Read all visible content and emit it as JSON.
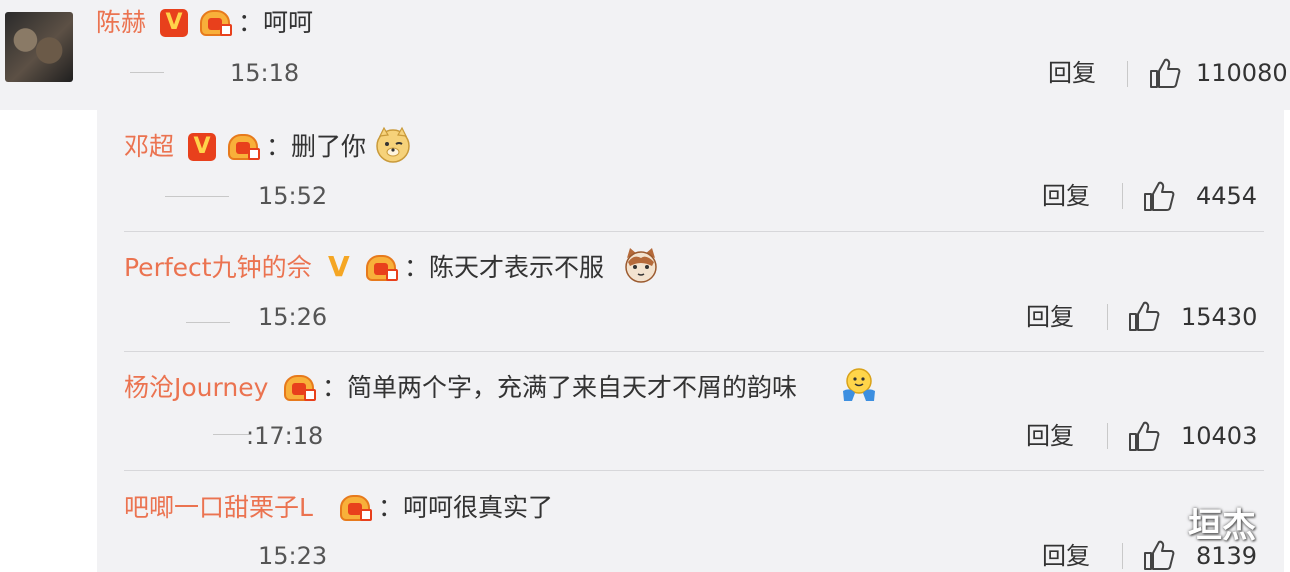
{
  "main_comment": {
    "user": "陈赫",
    "text": "：呵呵",
    "time": "15:18",
    "reply_label": "回复",
    "likes": "110080"
  },
  "replies": [
    {
      "user": "邓超",
      "text": "：删了你",
      "time": "15:52",
      "reply_label": "回复",
      "likes": "4454"
    },
    {
      "user": "Perfect九钟的佘",
      "text": "：陈天才表示不服",
      "time": "15:26",
      "reply_label": "回复",
      "likes": "15430"
    },
    {
      "user": "杨沧Journey",
      "text": "：简单两个字，充满了来自天才不屑的韵味",
      "time": ":17:18",
      "reply_label": "回复",
      "likes": "10403"
    },
    {
      "user": "吧唧一口甜栗子L",
      "text": "：呵呵很真实了",
      "time": "15:23",
      "reply_label": "回复",
      "likes": "8139"
    }
  ],
  "badges": {
    "verified": "V"
  },
  "watermark": "垣杰",
  "colors": {
    "nickname": "#eb7350",
    "panel_bg": "#f2f2f4",
    "verified_bg": "#e8401c"
  },
  "icons": [
    "avatar",
    "verified-badge-icon",
    "fan-badge-icon",
    "thumbs-up-icon",
    "doge-emoji",
    "cat-emoji",
    "hug-emoji"
  ]
}
